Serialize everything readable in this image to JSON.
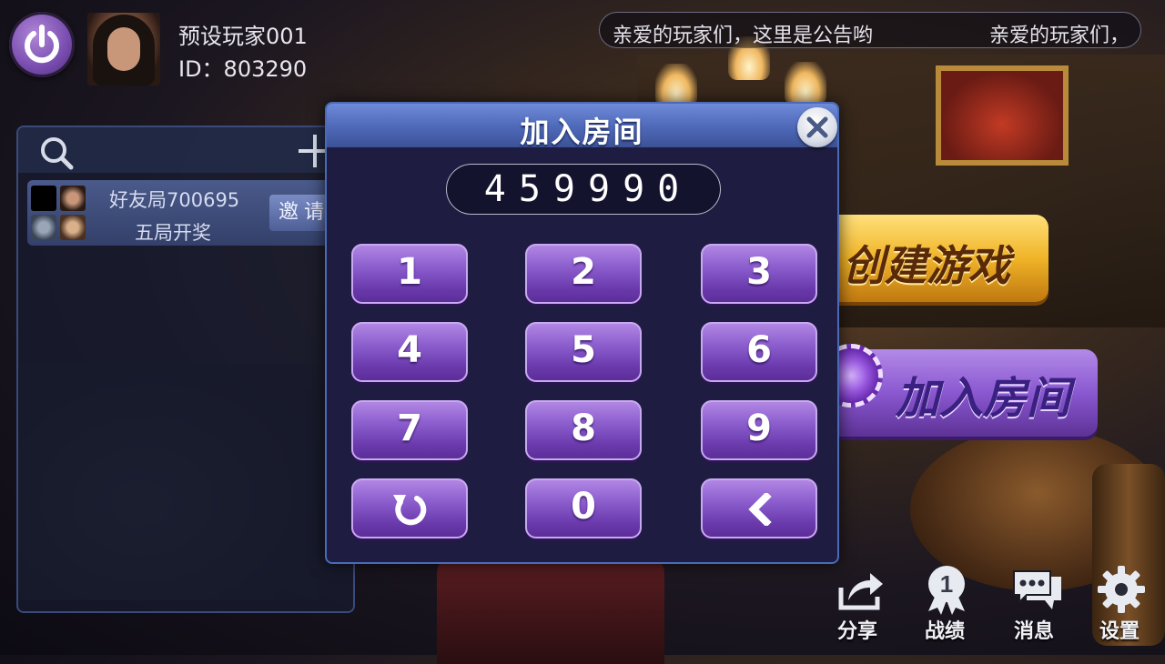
{
  "player": {
    "name": "预设玩家001",
    "id_label": "ID：803290"
  },
  "notice": {
    "text_a": "亲爱的玩家们，这里是公告哟",
    "text_b": "亲爱的玩家们，"
  },
  "friend_panel": {
    "rooms": [
      {
        "title": "好友局700695",
        "subtitle": "五局开奖",
        "invite_label": "邀请"
      }
    ]
  },
  "lobby_buttons": {
    "create_label": "创建游戏",
    "join_label": "加入房间"
  },
  "dialog": {
    "title": "加入房间",
    "room_code": "459990",
    "keys": [
      "1",
      "2",
      "3",
      "4",
      "5",
      "6",
      "7",
      "8",
      "9",
      "reset-icon",
      "0",
      "backspace-icon"
    ]
  },
  "bottom_nav": [
    {
      "label": "分享",
      "icon": "share-icon"
    },
    {
      "label": "战绩",
      "icon": "record-badge-icon",
      "badge": "1"
    },
    {
      "label": "消息",
      "icon": "message-icon"
    },
    {
      "label": "设置",
      "icon": "gear-icon"
    }
  ],
  "colors": {
    "dialog_header": "#4e68b8",
    "key_purple": "#8a5ccc",
    "create_gold": "#f0b428",
    "join_purple": "#8a58d0"
  }
}
